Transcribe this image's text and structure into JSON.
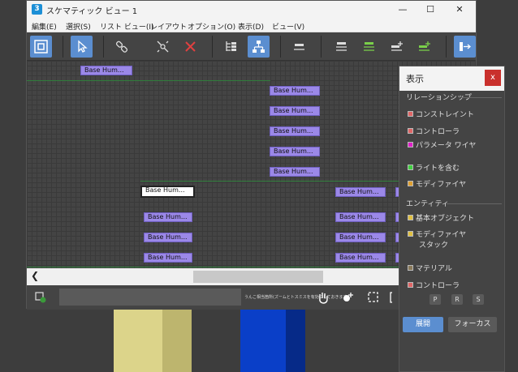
{
  "window": {
    "title": "スケマティック ビュー 1",
    "icon_letter": "3",
    "min_label": "—",
    "max_label": "☐",
    "close_label": "✕"
  },
  "menu": [
    "編集(E)",
    "選択(S)",
    "リスト ビュー(I)",
    "レイアウト",
    "オプション(O)",
    "表示(D)",
    "ビュー(V)"
  ],
  "nodes": {
    "label": "Base Hum...",
    "selected_label": "Base Hum..."
  },
  "status": {
    "hint": "うんこ相当箇所(ズームとトスミスを有効にしておきます。"
  },
  "panel": {
    "title": "表示",
    "close_label": "x",
    "relationships_label": "リレーションシップ",
    "relationships": [
      {
        "label": "コンストレイント",
        "color": "#e06666"
      },
      {
        "label": "コントローラ",
        "color": "#e06666"
      },
      {
        "label": "パラメータ ワイヤ",
        "color": "#e020c8"
      },
      {
        "label": "ライトを含む",
        "color": "#40d040"
      },
      {
        "label": "モディファイヤ",
        "color": "#e0a030"
      }
    ],
    "entities_label": "エンティティ",
    "entities": [
      {
        "label": "基本オブジェクト",
        "color": "#e0c040"
      },
      {
        "label": "モディファイヤ",
        "label2": "スタック",
        "color": "#e0c040"
      },
      {
        "label": "マテリアル",
        "color": "#8a7a5a"
      },
      {
        "label": "コントローラ",
        "color": "#e06666"
      }
    ],
    "prs": [
      "P",
      "R",
      "S"
    ],
    "expand_label": "展開",
    "focus_label": "フォーカス"
  },
  "colors": {
    "accent": "#5b8ed0",
    "node": "#9b88e8",
    "wire": "#2f7d3b"
  }
}
